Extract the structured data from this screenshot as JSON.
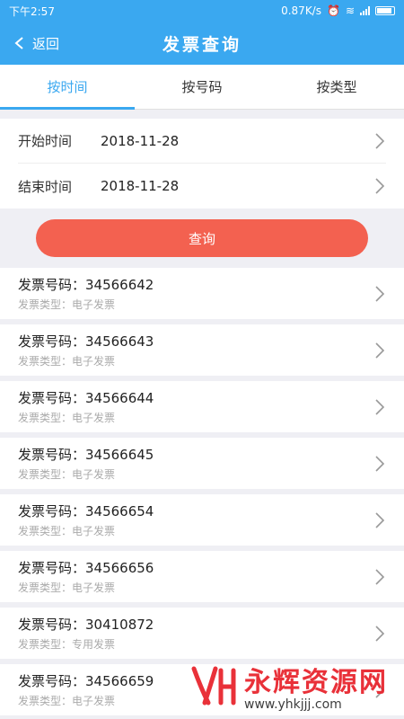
{
  "statusbar": {
    "time": "下午2:57",
    "speed": "0.87K/s"
  },
  "navbar": {
    "back_label": "返回",
    "title": "发票查询"
  },
  "tabs": [
    {
      "label": "按时间",
      "active": true
    },
    {
      "label": "按号码",
      "active": false
    },
    {
      "label": "按类型",
      "active": false
    }
  ],
  "form": {
    "start": {
      "label": "开始时间",
      "value": "2018-11-28"
    },
    "end": {
      "label": "结束时间",
      "value": "2018-11-28"
    }
  },
  "query_button": "查询",
  "colors": {
    "primary": "#3aa8f0",
    "button": "#f36150"
  },
  "invoices": [
    {
      "number": "发票号码：34566642",
      "type": "发票类型：电子发票"
    },
    {
      "number": "发票号码：34566643",
      "type": "发票类型：电子发票"
    },
    {
      "number": "发票号码：34566644",
      "type": "发票类型：电子发票"
    },
    {
      "number": "发票号码：34566645",
      "type": "发票类型：电子发票"
    },
    {
      "number": "发票号码：34566654",
      "type": "发票类型：电子发票"
    },
    {
      "number": "发票号码：34566656",
      "type": "发票类型：电子发票"
    },
    {
      "number": "发票号码：30410872",
      "type": "发票类型：专用发票"
    },
    {
      "number": "发票号码：34566659",
      "type": "发票类型：电子发票"
    }
  ],
  "watermark": {
    "title": "永辉资源网",
    "url": "www.yhkjjj.com"
  }
}
